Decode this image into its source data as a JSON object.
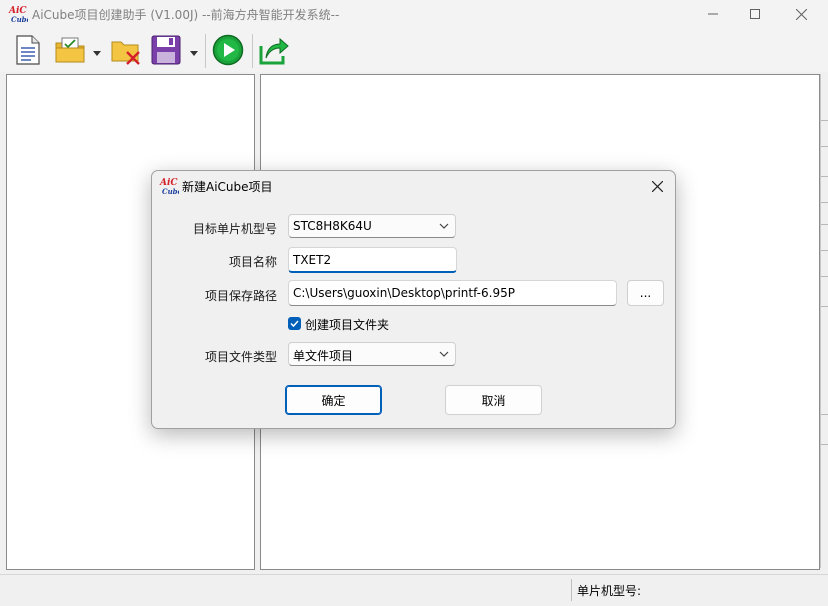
{
  "app": {
    "title": "AiCube项目创建助手 (V1.00J) --前海方舟智能开发系统--",
    "logo_text_top": "AiC",
    "logo_text_bottom": "Cube"
  },
  "window_controls": {
    "minimize_icon": "minimize-icon",
    "maximize_icon": "maximize-icon",
    "close_icon": "close-icon"
  },
  "toolbar": {
    "items": [
      "new-document-icon",
      "open-project-icon",
      "close-project-icon",
      "save-icon",
      "run-icon",
      "export-icon"
    ]
  },
  "statusbar": {
    "mcu_model_label": "单片机型号:"
  },
  "dialog": {
    "title": "新建AiCube项目",
    "mcu_label": "目标单片机型号",
    "mcu_value": "STC8H8K64U",
    "name_label": "项目名称",
    "name_value": "TXET2",
    "path_label": "项目保存路径",
    "path_value": "C:\\Users\\guoxin\\Desktop\\printf-6.95P",
    "browse_label": "...",
    "create_folder_label": "创建项目文件夹",
    "create_folder_checked": true,
    "filetype_label": "项目文件类型",
    "filetype_value": "单文件项目",
    "ok_label": "确定",
    "cancel_label": "取消"
  },
  "colors": {
    "accent": "#005fb8",
    "logo_red": "#d4202a",
    "logo_blue": "#1c3f9e",
    "run_green": "#1aa33a",
    "folder_yellow": "#f4c542",
    "save_purple": "#7a3fa8"
  }
}
